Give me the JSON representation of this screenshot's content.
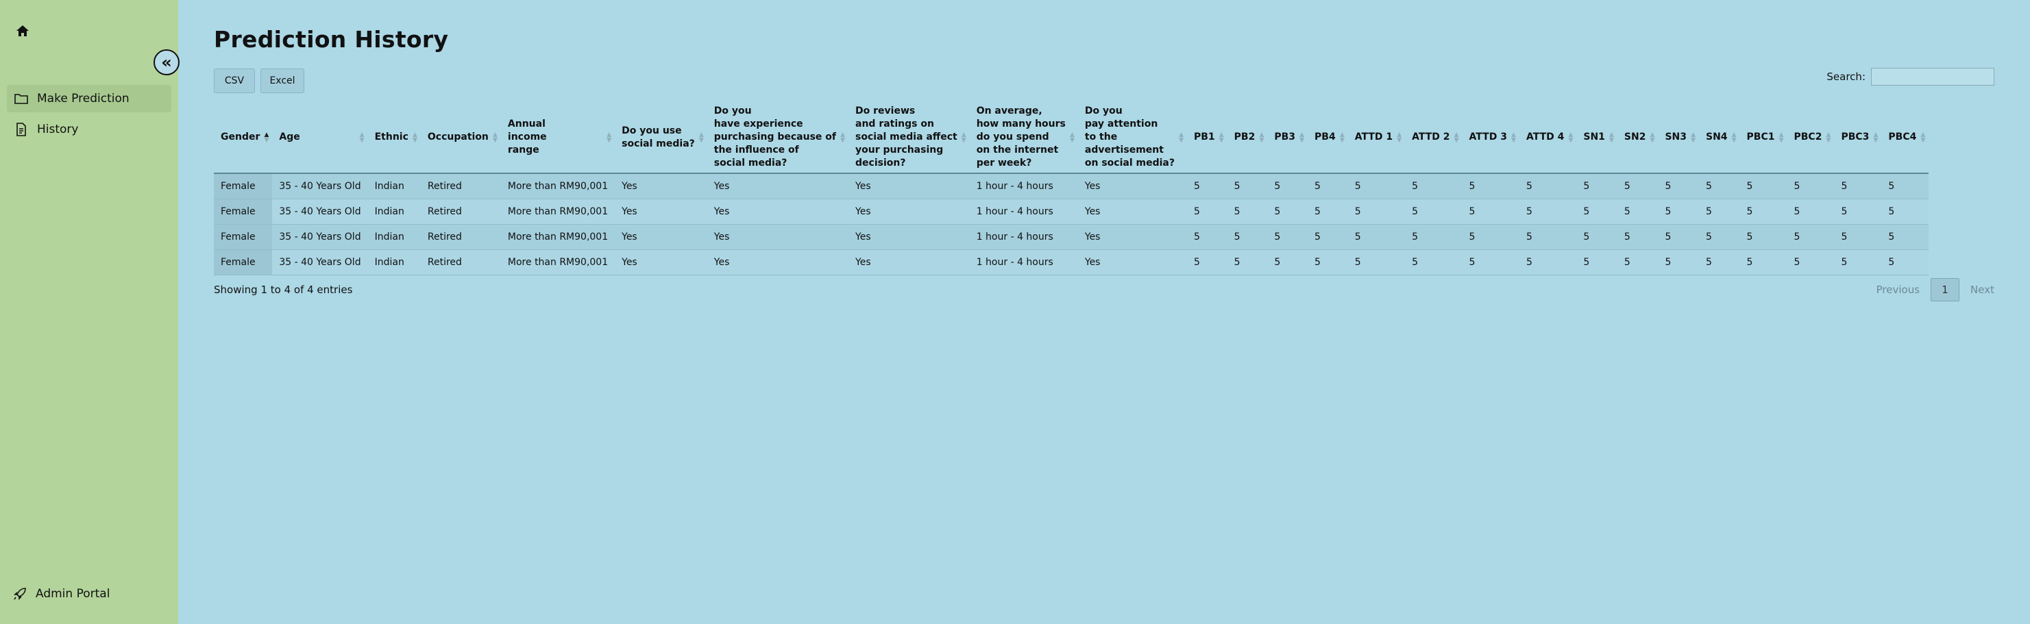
{
  "sidebar": {
    "nav": [
      {
        "label": "Make Prediction",
        "icon": "folder-icon"
      },
      {
        "label": "History",
        "icon": "document-icon"
      }
    ],
    "admin_label": "Admin Portal",
    "collapse_glyph": "«"
  },
  "page": {
    "title": "Prediction History",
    "export_buttons": [
      "CSV",
      "Excel"
    ],
    "search_label": "Search:",
    "search_value": ""
  },
  "table": {
    "columns": [
      "Gender",
      "Age",
      "Ethnic",
      "Occupation",
      "Annual\nincome\nrange",
      "Do you use\nsocial media?",
      "Do you\nhave experience\npurchasing because of\nthe influence of\nsocial media?",
      "Do reviews\nand ratings on\nsocial media affect\nyour purchasing\ndecision?",
      "On average,\nhow many hours\ndo you spend\non the internet\nper week?",
      "Do you\npay attention\nto the\nadvertisement\non social media?",
      "PB1",
      "PB2",
      "PB3",
      "PB4",
      "ATTD 1",
      "ATTD 2",
      "ATTD 3",
      "ATTD 4",
      "SN1",
      "SN2",
      "SN3",
      "SN4",
      "PBC1",
      "PBC2",
      "PBC3",
      "PBC4"
    ],
    "rows": [
      [
        "Female",
        "35 - 40 Years Old",
        "Indian",
        "Retired",
        "More than RM90,001",
        "Yes",
        "Yes",
        "Yes",
        "1 hour - 4 hours",
        "Yes",
        "5",
        "5",
        "5",
        "5",
        "5",
        "5",
        "5",
        "5",
        "5",
        "5",
        "5",
        "5",
        "5",
        "5",
        "5",
        "5"
      ],
      [
        "Female",
        "35 - 40 Years Old",
        "Indian",
        "Retired",
        "More than RM90,001",
        "Yes",
        "Yes",
        "Yes",
        "1 hour - 4 hours",
        "Yes",
        "5",
        "5",
        "5",
        "5",
        "5",
        "5",
        "5",
        "5",
        "5",
        "5",
        "5",
        "5",
        "5",
        "5",
        "5",
        "5"
      ],
      [
        "Female",
        "35 - 40 Years Old",
        "Indian",
        "Retired",
        "More than RM90,001",
        "Yes",
        "Yes",
        "Yes",
        "1 hour - 4 hours",
        "Yes",
        "5",
        "5",
        "5",
        "5",
        "5",
        "5",
        "5",
        "5",
        "5",
        "5",
        "5",
        "5",
        "5",
        "5",
        "5",
        "5"
      ],
      [
        "Female",
        "35 - 40 Years Old",
        "Indian",
        "Retired",
        "More than RM90,001",
        "Yes",
        "Yes",
        "Yes",
        "1 hour - 4 hours",
        "Yes",
        "5",
        "5",
        "5",
        "5",
        "5",
        "5",
        "5",
        "5",
        "5",
        "5",
        "5",
        "5",
        "5",
        "5",
        "5",
        "5"
      ]
    ],
    "sorted_column_index": 0
  },
  "footer": {
    "info": "Showing 1 to 4 of 4 entries",
    "previous": "Previous",
    "current_page": "1",
    "next": "Next"
  }
}
